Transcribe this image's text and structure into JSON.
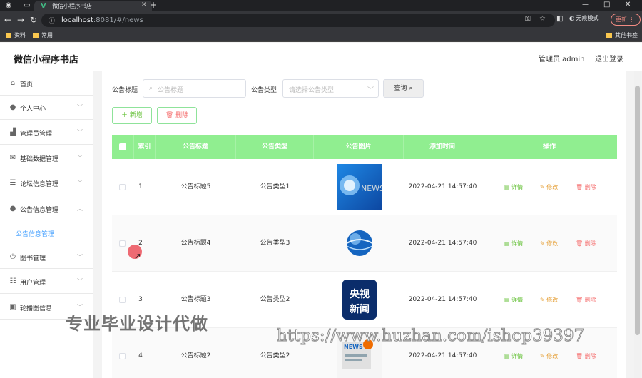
{
  "browser": {
    "tab_title": "微信小程序书店",
    "url_host": "localhost",
    "url_rest": ":8081/#/news",
    "incognito": "无痕模式",
    "update_label": "更新",
    "bookmarks": [
      "资料",
      "常用"
    ],
    "other_bookmarks": "其他书签"
  },
  "header": {
    "app_title": "微信小程序书店",
    "admin_label": "管理员 admin",
    "logout_label": "退出登录"
  },
  "sidebar": {
    "items": [
      {
        "label": "首页",
        "icon": "home-icon"
      },
      {
        "label": "个人中心",
        "icon": "user-icon"
      },
      {
        "label": "管理员管理",
        "icon": "chart-icon"
      },
      {
        "label": "基础数据管理",
        "icon": "mail-icon"
      },
      {
        "label": "论坛信息管理",
        "icon": "list-icon"
      },
      {
        "label": "公告信息管理",
        "icon": "user-icon"
      },
      {
        "label": "图书管理",
        "icon": "power-icon"
      },
      {
        "label": "用户管理",
        "icon": "sliders-icon"
      },
      {
        "label": "轮播图信息",
        "icon": "image-icon"
      }
    ],
    "sub_item": "公告信息管理"
  },
  "search": {
    "title_label": "公告标题",
    "title_placeholder": "公告标题",
    "type_label": "公告类型",
    "type_placeholder": "请选择公告类型",
    "query_label": "查询"
  },
  "toolbar": {
    "add_label": "新增",
    "delete_label": "删除"
  },
  "table": {
    "headers": [
      "索引",
      "公告标题",
      "公告类型",
      "公告图片",
      "添加时间",
      "操作"
    ],
    "rows": [
      {
        "index": "1",
        "title": "公告标题5",
        "type": "公告类型1",
        "time": "2022-04-21 14:57:40"
      },
      {
        "index": "2",
        "title": "公告标题4",
        "type": "公告类型3",
        "time": "2022-04-21 14:57:40"
      },
      {
        "index": "3",
        "title": "公告标题3",
        "type": "公告类型2",
        "time": "2022-04-21 14:57:40"
      },
      {
        "index": "4",
        "title": "公告标题2",
        "type": "公告类型2",
        "time": "2022-04-21 14:57:40"
      }
    ],
    "actions": {
      "detail": "详情",
      "edit": "修改",
      "remove": "删除"
    },
    "thumb3_text": [
      "央视",
      "新闻"
    ],
    "thumb1_text": "NEWS",
    "thumb4_text": "NEWS"
  },
  "watermarks": {
    "left": "专业毕业设计代做",
    "right": "https://www.huzhan.com/ishop39397"
  },
  "colors": {
    "header_green": "#90ee90",
    "accent_blue": "#409eff",
    "detail_green": "#67c23a",
    "edit_orange": "#e6a23c",
    "delete_red": "#f56c6c"
  }
}
